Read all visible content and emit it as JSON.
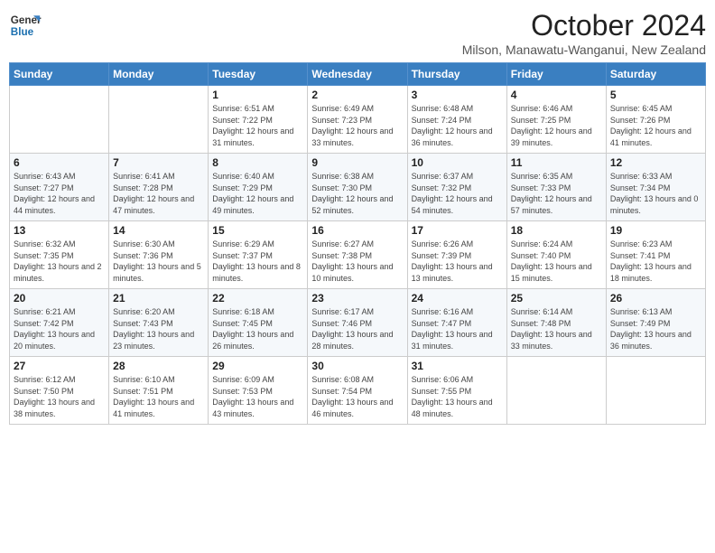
{
  "header": {
    "title": "October 2024",
    "location": "Milson, Manawatu-Wanganui, New Zealand",
    "logo_line1": "General",
    "logo_line2": "Blue"
  },
  "days_of_week": [
    "Sunday",
    "Monday",
    "Tuesday",
    "Wednesday",
    "Thursday",
    "Friday",
    "Saturday"
  ],
  "weeks": [
    [
      {
        "day": "",
        "info": ""
      },
      {
        "day": "",
        "info": ""
      },
      {
        "day": "1",
        "info": "Sunrise: 6:51 AM\nSunset: 7:22 PM\nDaylight: 12 hours and 31 minutes."
      },
      {
        "day": "2",
        "info": "Sunrise: 6:49 AM\nSunset: 7:23 PM\nDaylight: 12 hours and 33 minutes."
      },
      {
        "day": "3",
        "info": "Sunrise: 6:48 AM\nSunset: 7:24 PM\nDaylight: 12 hours and 36 minutes."
      },
      {
        "day": "4",
        "info": "Sunrise: 6:46 AM\nSunset: 7:25 PM\nDaylight: 12 hours and 39 minutes."
      },
      {
        "day": "5",
        "info": "Sunrise: 6:45 AM\nSunset: 7:26 PM\nDaylight: 12 hours and 41 minutes."
      }
    ],
    [
      {
        "day": "6",
        "info": "Sunrise: 6:43 AM\nSunset: 7:27 PM\nDaylight: 12 hours and 44 minutes."
      },
      {
        "day": "7",
        "info": "Sunrise: 6:41 AM\nSunset: 7:28 PM\nDaylight: 12 hours and 47 minutes."
      },
      {
        "day": "8",
        "info": "Sunrise: 6:40 AM\nSunset: 7:29 PM\nDaylight: 12 hours and 49 minutes."
      },
      {
        "day": "9",
        "info": "Sunrise: 6:38 AM\nSunset: 7:30 PM\nDaylight: 12 hours and 52 minutes."
      },
      {
        "day": "10",
        "info": "Sunrise: 6:37 AM\nSunset: 7:32 PM\nDaylight: 12 hours and 54 minutes."
      },
      {
        "day": "11",
        "info": "Sunrise: 6:35 AM\nSunset: 7:33 PM\nDaylight: 12 hours and 57 minutes."
      },
      {
        "day": "12",
        "info": "Sunrise: 6:33 AM\nSunset: 7:34 PM\nDaylight: 13 hours and 0 minutes."
      }
    ],
    [
      {
        "day": "13",
        "info": "Sunrise: 6:32 AM\nSunset: 7:35 PM\nDaylight: 13 hours and 2 minutes."
      },
      {
        "day": "14",
        "info": "Sunrise: 6:30 AM\nSunset: 7:36 PM\nDaylight: 13 hours and 5 minutes."
      },
      {
        "day": "15",
        "info": "Sunrise: 6:29 AM\nSunset: 7:37 PM\nDaylight: 13 hours and 8 minutes."
      },
      {
        "day": "16",
        "info": "Sunrise: 6:27 AM\nSunset: 7:38 PM\nDaylight: 13 hours and 10 minutes."
      },
      {
        "day": "17",
        "info": "Sunrise: 6:26 AM\nSunset: 7:39 PM\nDaylight: 13 hours and 13 minutes."
      },
      {
        "day": "18",
        "info": "Sunrise: 6:24 AM\nSunset: 7:40 PM\nDaylight: 13 hours and 15 minutes."
      },
      {
        "day": "19",
        "info": "Sunrise: 6:23 AM\nSunset: 7:41 PM\nDaylight: 13 hours and 18 minutes."
      }
    ],
    [
      {
        "day": "20",
        "info": "Sunrise: 6:21 AM\nSunset: 7:42 PM\nDaylight: 13 hours and 20 minutes."
      },
      {
        "day": "21",
        "info": "Sunrise: 6:20 AM\nSunset: 7:43 PM\nDaylight: 13 hours and 23 minutes."
      },
      {
        "day": "22",
        "info": "Sunrise: 6:18 AM\nSunset: 7:45 PM\nDaylight: 13 hours and 26 minutes."
      },
      {
        "day": "23",
        "info": "Sunrise: 6:17 AM\nSunset: 7:46 PM\nDaylight: 13 hours and 28 minutes."
      },
      {
        "day": "24",
        "info": "Sunrise: 6:16 AM\nSunset: 7:47 PM\nDaylight: 13 hours and 31 minutes."
      },
      {
        "day": "25",
        "info": "Sunrise: 6:14 AM\nSunset: 7:48 PM\nDaylight: 13 hours and 33 minutes."
      },
      {
        "day": "26",
        "info": "Sunrise: 6:13 AM\nSunset: 7:49 PM\nDaylight: 13 hours and 36 minutes."
      }
    ],
    [
      {
        "day": "27",
        "info": "Sunrise: 6:12 AM\nSunset: 7:50 PM\nDaylight: 13 hours and 38 minutes."
      },
      {
        "day": "28",
        "info": "Sunrise: 6:10 AM\nSunset: 7:51 PM\nDaylight: 13 hours and 41 minutes."
      },
      {
        "day": "29",
        "info": "Sunrise: 6:09 AM\nSunset: 7:53 PM\nDaylight: 13 hours and 43 minutes."
      },
      {
        "day": "30",
        "info": "Sunrise: 6:08 AM\nSunset: 7:54 PM\nDaylight: 13 hours and 46 minutes."
      },
      {
        "day": "31",
        "info": "Sunrise: 6:06 AM\nSunset: 7:55 PM\nDaylight: 13 hours and 48 minutes."
      },
      {
        "day": "",
        "info": ""
      },
      {
        "day": "",
        "info": ""
      }
    ]
  ]
}
